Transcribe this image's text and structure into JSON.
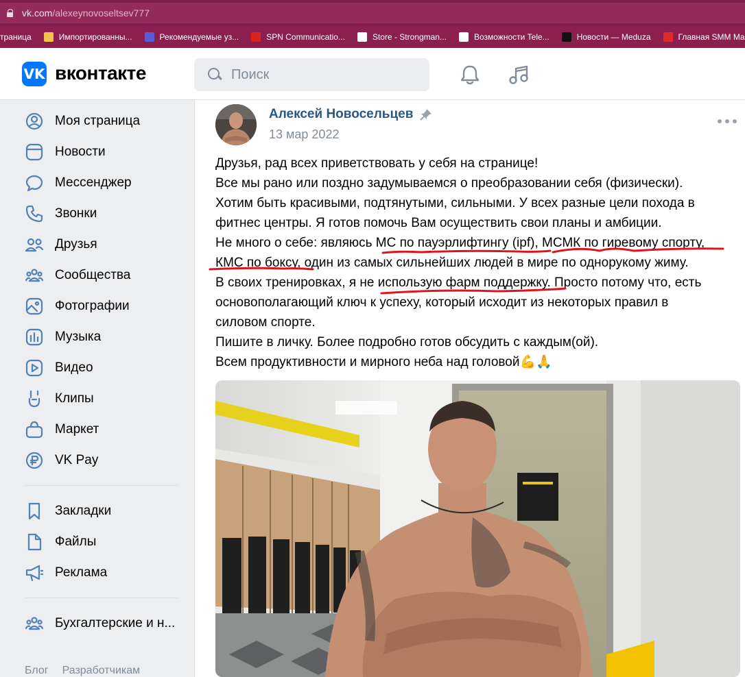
{
  "browser": {
    "url_host": "vk.com",
    "url_path": "/alexeynovoseltsev777",
    "bookmarks": [
      {
        "label": "траница",
        "icon": "none-icon",
        "color": "transparent"
      },
      {
        "label": "Импортированны...",
        "icon": "folder-icon",
        "color": "#f2c14e"
      },
      {
        "label": "Рекомендуемые уз...",
        "icon": "search-icon",
        "color": "#5b5bd6"
      },
      {
        "label": "SPN Communicatio...",
        "icon": "spn-icon",
        "color": "#d9231f"
      },
      {
        "label": "Store - Strongman...",
        "icon": "store-icon",
        "color": "#ffffff"
      },
      {
        "label": "Возможности Tele...",
        "icon": "t-icon",
        "color": "#ffffff"
      },
      {
        "label": "Новости — Meduza",
        "icon": "meduza-icon",
        "color": "#111111"
      },
      {
        "label": "Главная SMM Map...",
        "icon": "smm-icon",
        "color": "#e02b2b"
      }
    ]
  },
  "header": {
    "logo_text": "вконтакте",
    "search_placeholder": "Поиск"
  },
  "sidebar": {
    "main": [
      {
        "label": "Моя страница",
        "icon": "user-circle-icon"
      },
      {
        "label": "Новости",
        "icon": "news-icon"
      },
      {
        "label": "Мессенджер",
        "icon": "message-icon"
      },
      {
        "label": "Звонки",
        "icon": "phone-icon"
      },
      {
        "label": "Друзья",
        "icon": "friends-icon"
      },
      {
        "label": "Сообщества",
        "icon": "communities-icon"
      },
      {
        "label": "Фотографии",
        "icon": "photo-icon"
      },
      {
        "label": "Музыка",
        "icon": "music-icon"
      },
      {
        "label": "Видео",
        "icon": "video-icon"
      },
      {
        "label": "Клипы",
        "icon": "clips-icon"
      },
      {
        "label": "Маркет",
        "icon": "market-icon"
      },
      {
        "label": "VK Pay",
        "icon": "vkpay-icon"
      }
    ],
    "secondary": [
      {
        "label": "Закладки",
        "icon": "bookmark-icon"
      },
      {
        "label": "Файлы",
        "icon": "file-icon"
      },
      {
        "label": "Реклама",
        "icon": "megaphone-icon"
      }
    ],
    "tertiary": [
      {
        "label": "Бухгалтерские и н...",
        "icon": "communities-icon"
      }
    ],
    "footer": [
      "Блог",
      "Разработчикам"
    ]
  },
  "post": {
    "author": "Алексей Новосельцев",
    "date": "13 мар 2022",
    "lines": [
      "Друзья, рад всех приветствовать у себя на странице!",
      "Все мы рано или поздно задумываемся о преобразовании себя (физически).",
      "Хотим быть красивыми, подтянутыми, сильными. У всех разные цели похода в",
      "фитнес центры. Я готов помочь Вам осуществить свои планы и амбиции.",
      "Не много о себе: являюсь МС по пауэрлифтингу (ipf), МСМК по гиревому спорту,",
      "КМС по боксу, один из самых сильнейших людей в мире по однорукому жиму.",
      "В своих тренировках, я не использую фарм поддержку. Просто потому что, есть",
      "основополагающий ключ к успеху, который исходит из некоторых правил в",
      "силовом спорте.",
      "Пишите в личку. Более подробно готов обсудить с каждым(ой).",
      "Всем продуктивности и мирного неба над головой💪🙏"
    ]
  },
  "colors": {
    "accent": "#0077ff",
    "link": "#2a5885",
    "annotation": "#e0141e"
  }
}
